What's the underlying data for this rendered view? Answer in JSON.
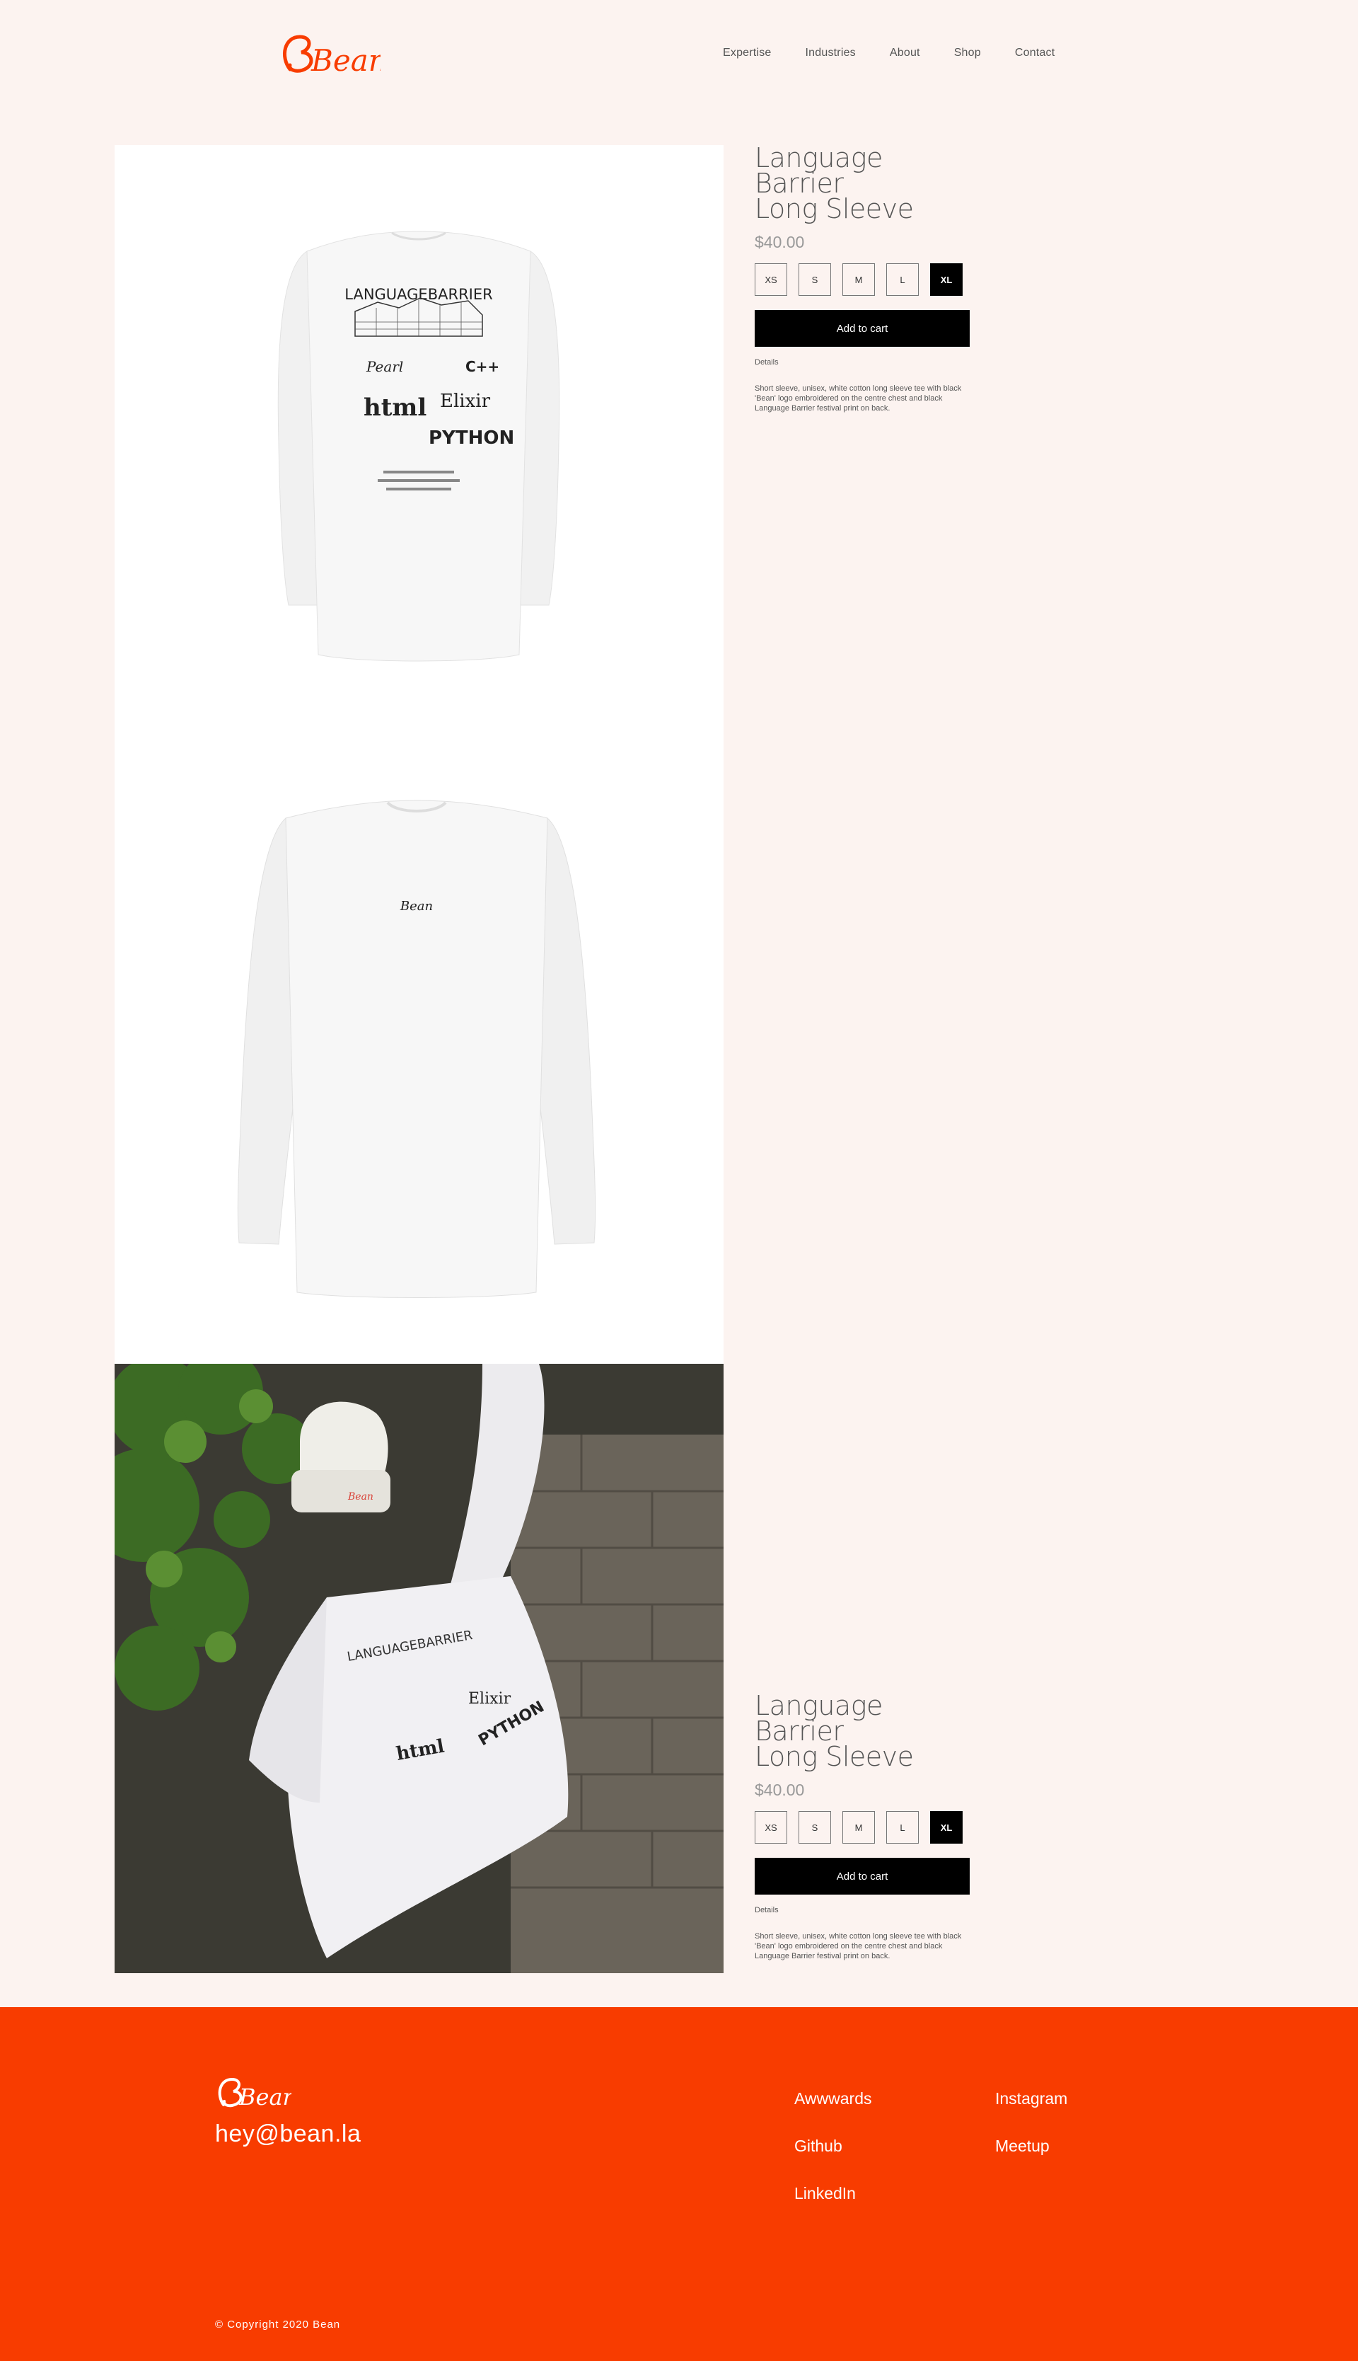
{
  "header": {
    "logo_text": "Bean",
    "nav": [
      {
        "label": "Expertise"
      },
      {
        "label": "Industries"
      },
      {
        "label": "About"
      },
      {
        "label": "Shop"
      },
      {
        "label": "Contact"
      }
    ]
  },
  "gallery": {
    "images": [
      {
        "alt": "long-sleeve-back-print"
      },
      {
        "alt": "long-sleeve-front-logo"
      },
      {
        "alt": "long-sleeve-model-photo"
      }
    ],
    "print_text": {
      "headline": "LANGUAGEBARRIER",
      "words": [
        "Pearl",
        "C++",
        "html",
        "Elixir",
        "PYTHON"
      ],
      "front_logo": "Bean",
      "beanie_logo": "Bean"
    }
  },
  "product_panels": [
    {
      "title_line1": "Language Barrier",
      "title_line2": "Long Sleeve",
      "price": "$40.00",
      "sizes": [
        "XS",
        "S",
        "M",
        "L",
        "XL"
      ],
      "selected_size": "XL",
      "add_to_cart": "Add to cart",
      "details_label": "Details",
      "description": "Short sleeve, unisex, white cotton long sleeve tee with  black 'Bean' logo embroidered on the centre chest and black Language Barrier festival print on back."
    },
    {
      "title_line1": "Language Barrier",
      "title_line2": "Long Sleeve",
      "price": "$40.00",
      "sizes": [
        "XS",
        "S",
        "M",
        "L",
        "XL"
      ],
      "selected_size": "XL",
      "add_to_cart": "Add to cart",
      "details_label": "Details",
      "description": "Short sleeve, unisex, white cotton long sleeve tee with  black 'Bean' logo embroidered on the centre chest and black Language Barrier festival print on back."
    }
  ],
  "footer": {
    "logo_text": "Bean",
    "email": "hey@bean.la",
    "links": [
      {
        "label": "Awwwards"
      },
      {
        "label": "Instagram"
      },
      {
        "label": "Github"
      },
      {
        "label": "Meetup"
      },
      {
        "label": "LinkedIn"
      }
    ],
    "copyright": "© Copyright 2020 Bean"
  },
  "colors": {
    "background": "#fcf3f0",
    "brand_orange": "#f83c00",
    "black": "#000000"
  }
}
